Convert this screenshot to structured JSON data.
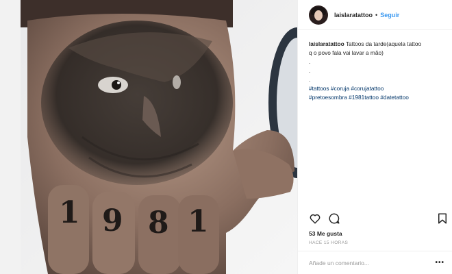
{
  "post": {
    "username": "laislaratattoo",
    "separator": "•",
    "follow_label": "Seguir",
    "caption": {
      "username": "laislaratattoo",
      "text_line1": "Tattoos da tarde(aquela tattoo",
      "text_line2": "q o povo fala vai lavar a mão)",
      "dots": [
        ".",
        ".",
        "."
      ],
      "hashtags_line1": [
        "#tattoos",
        "#coruja",
        "#corujatattoo"
      ],
      "hashtags_line2": [
        "#pretoesombra",
        "#1981tattoo",
        "#datetattoo"
      ]
    },
    "likes": "53 Me gusta",
    "timestamp": "HACE 15 HORAS",
    "comment_placeholder": "Añade un comentario...",
    "more_label": "•••"
  },
  "photo": {
    "knuckle_digits": [
      "1",
      "9",
      "8",
      "1"
    ]
  },
  "icons": {
    "like": "heart-icon",
    "comment": "comment-icon",
    "save": "bookmark-icon",
    "more": "more-options-icon"
  },
  "colors": {
    "link": "#3897f0",
    "hashtag": "#003569",
    "muted": "#999999",
    "text": "#262626"
  }
}
